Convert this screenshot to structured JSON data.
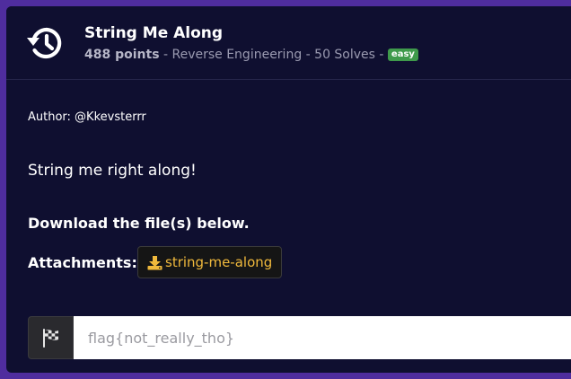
{
  "challenge": {
    "title": "String Me Along",
    "points": "488 points",
    "meta": " - Reverse Engineering - 50 Solves - ",
    "difficulty": "easy",
    "icon": "history-icon"
  },
  "body": {
    "author": "Author: @Kkevsterrr",
    "description": "String me right along!",
    "download_note": "Download the file(s) below.",
    "attachments_label": "Attachments:"
  },
  "attachment": {
    "label": "string-me-along",
    "icon": "download-icon"
  },
  "flag": {
    "placeholder": "flag{not_really_tho}",
    "value": "",
    "icon": "checkered-flag-icon"
  },
  "colors": {
    "page_bg": "#4f2d9e",
    "panel_bg": "#0f0f30",
    "badge": "#3f9a4b",
    "attachment_text": "#f0b93c"
  }
}
